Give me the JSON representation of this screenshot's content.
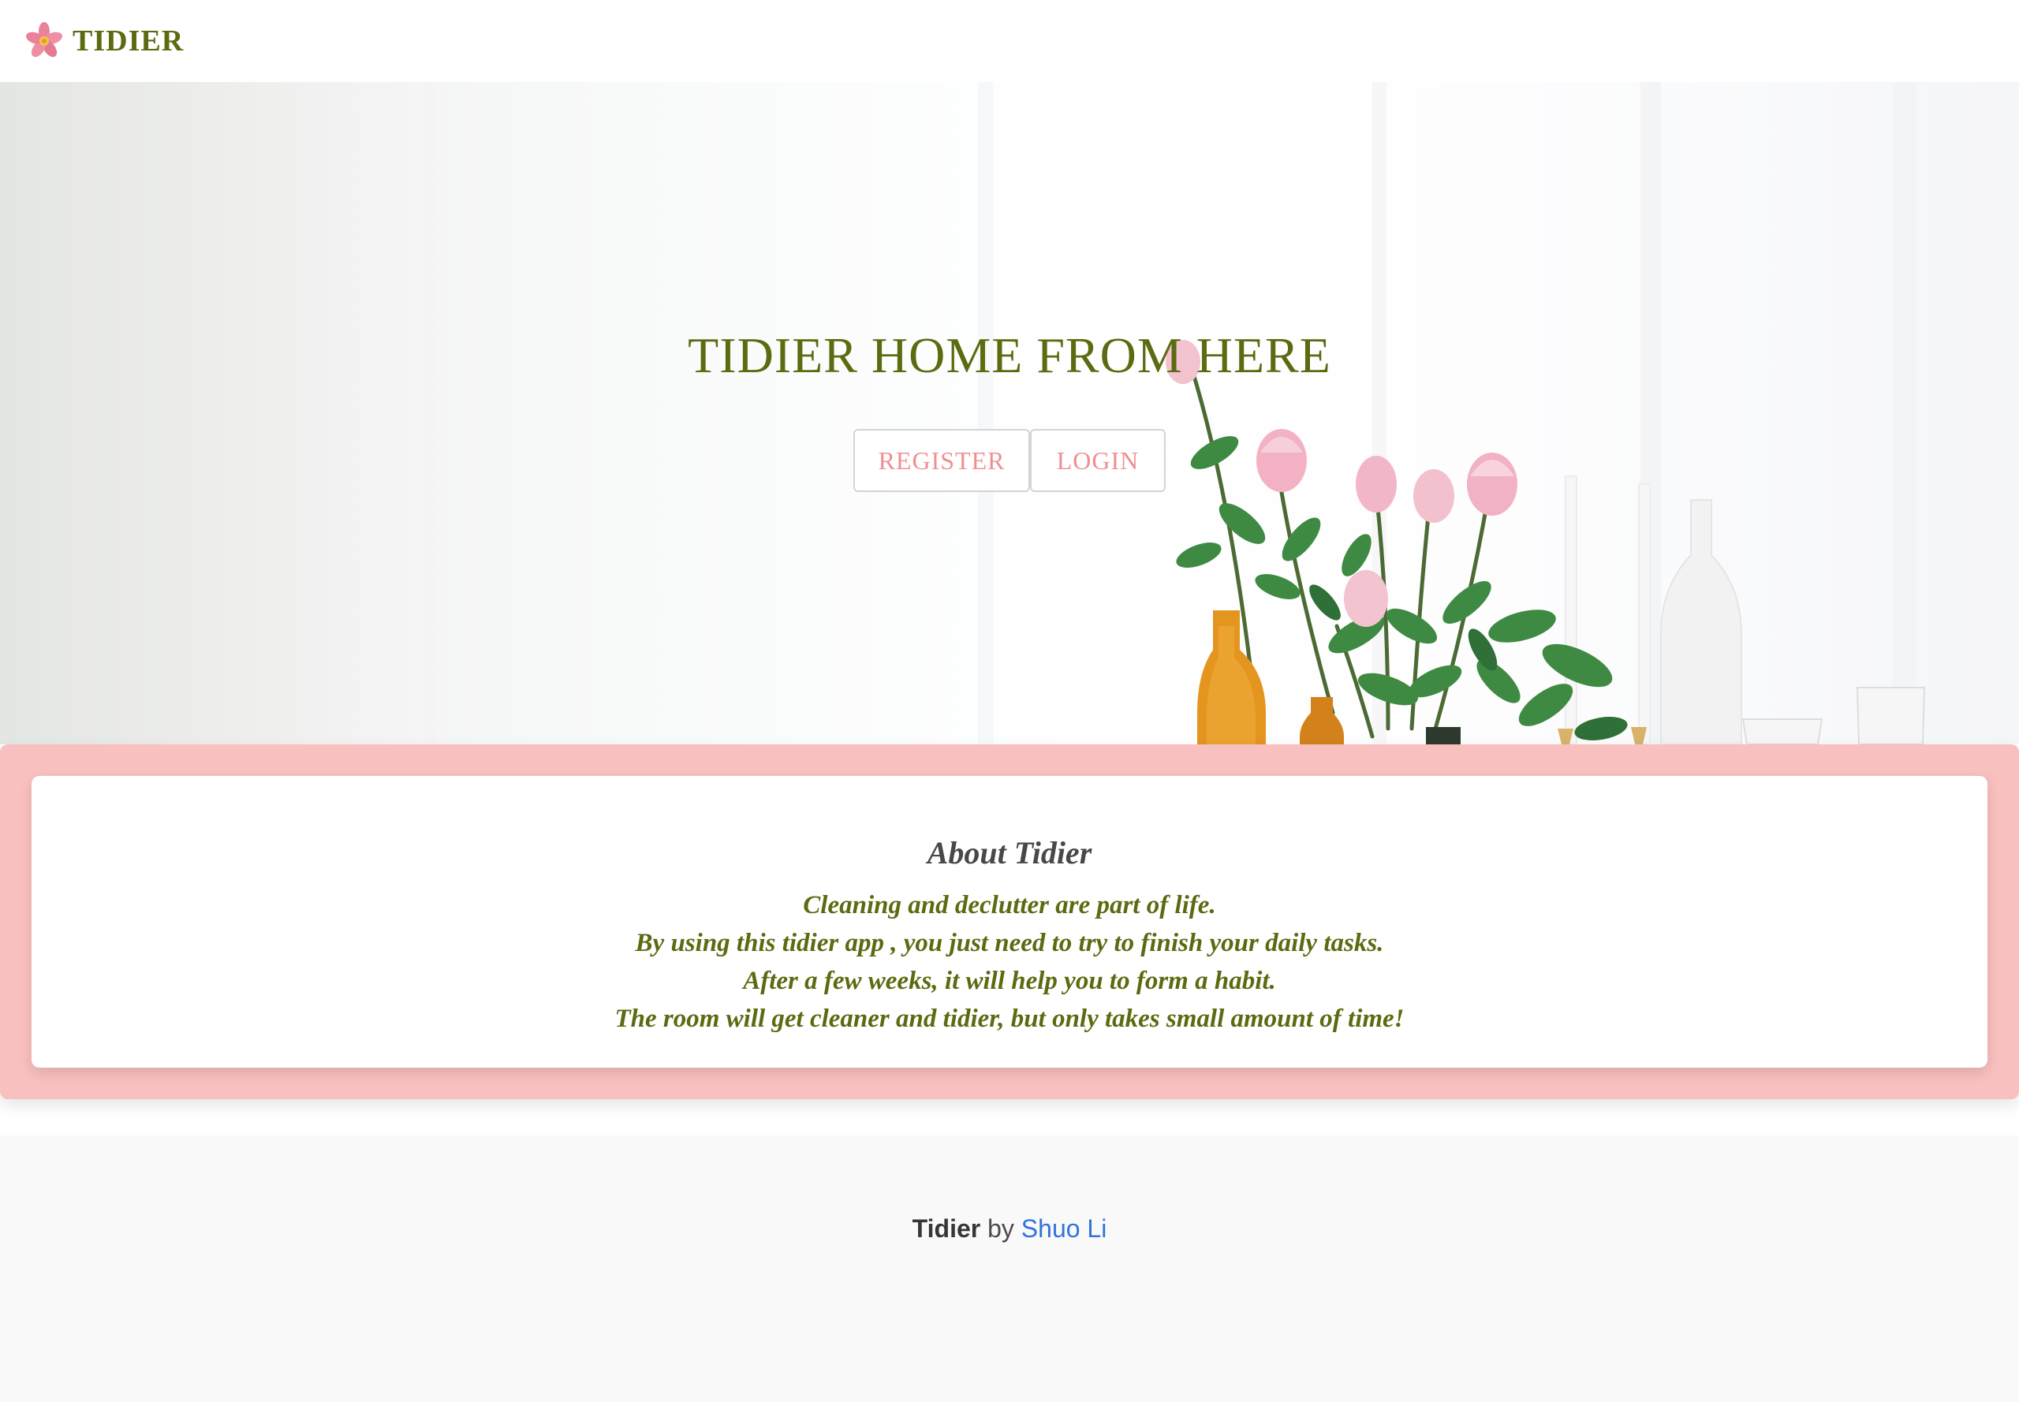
{
  "nav": {
    "brand": "TIDIER",
    "logo_icon": "flower-icon"
  },
  "hero": {
    "title": "TIDIER HOME FROM HERE",
    "register_label": "REGISTER",
    "login_label": "LOGIN"
  },
  "about": {
    "title": "About Tidier",
    "lines": [
      "Cleaning and declutter are part of life.",
      "By using this tidier app , you just need to try to finish your daily tasks.",
      "After a few weeks, it will help you to form a habit.",
      "The room will get cleaner and tidier, but only takes small amount of time!"
    ]
  },
  "footer": {
    "brand": "Tidier",
    "by": "by",
    "author": "Shuo Li"
  },
  "colors": {
    "brand_green": "#5a6b10",
    "accent_pink": "#f08f91",
    "about_band": "#f8c0bf",
    "link_blue": "#3273dc",
    "footer_bg": "#f9f9f9"
  }
}
